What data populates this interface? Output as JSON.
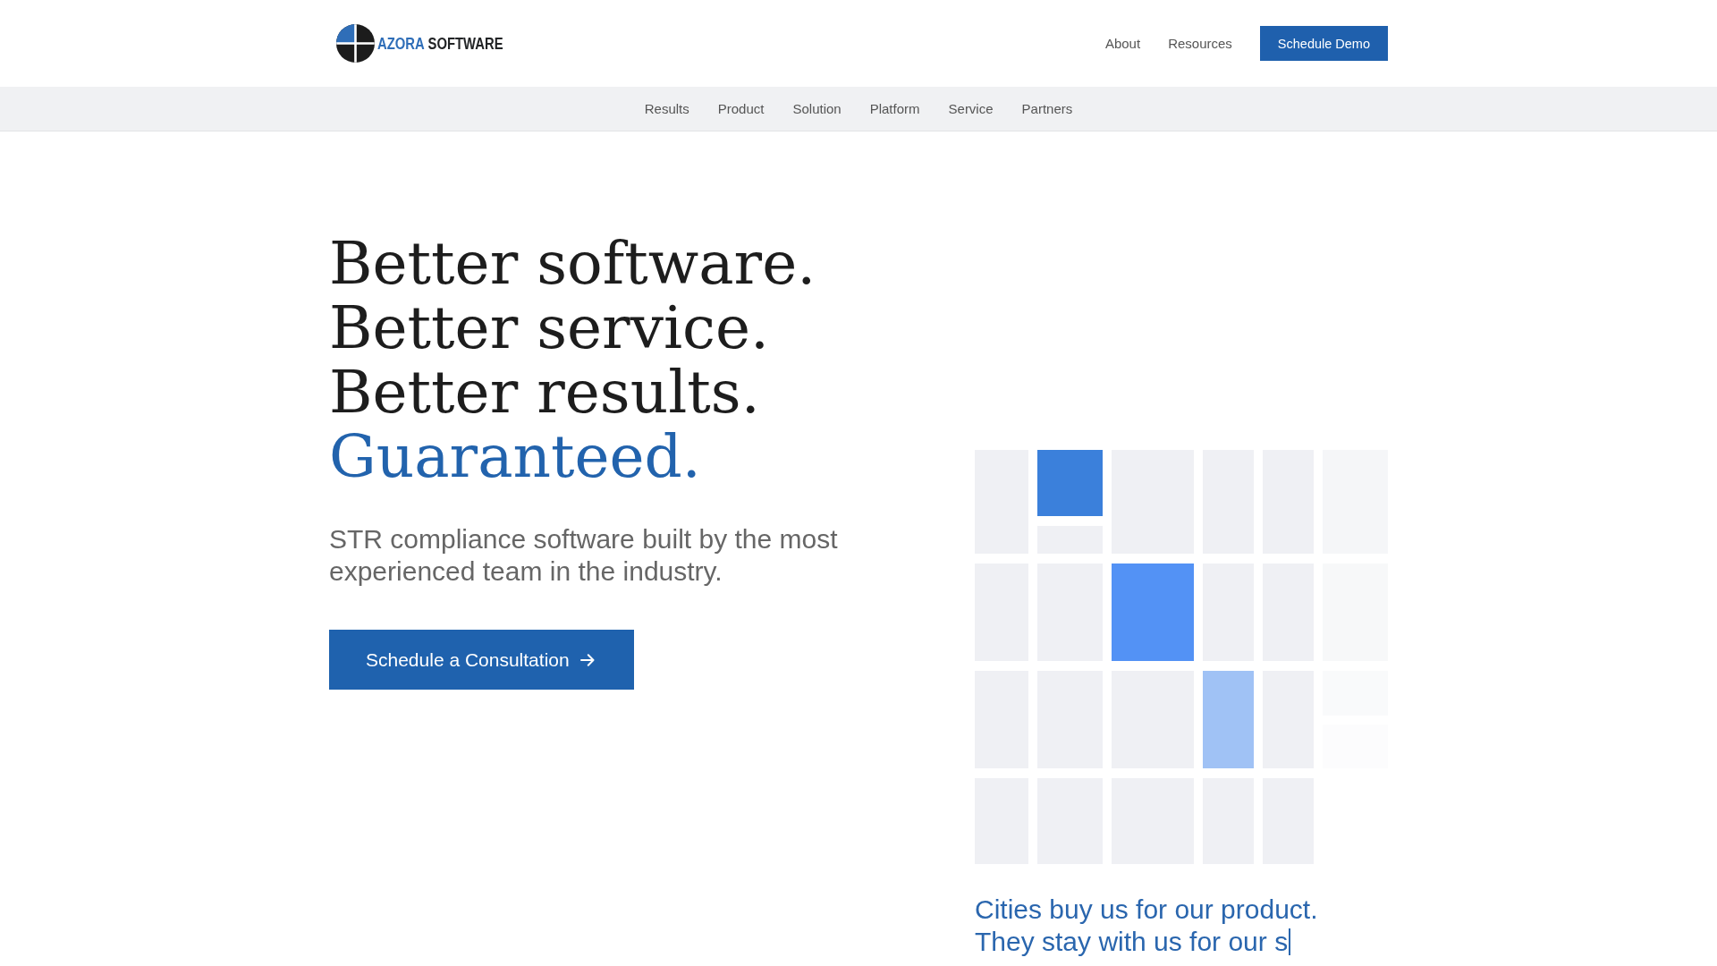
{
  "header": {
    "logo": {
      "brand": "AZORA",
      "product": "SOFTWARE"
    },
    "nav": [
      "About",
      "Resources"
    ],
    "cta": "Schedule Demo"
  },
  "subnav": {
    "items": [
      "Results",
      "Product",
      "Solution",
      "Platform",
      "Service",
      "Partners"
    ]
  },
  "hero": {
    "heading": [
      {
        "text": "Better software.",
        "accent": false
      },
      {
        "text": "Better service.",
        "accent": false
      },
      {
        "text": "Better results.",
        "accent": false
      },
      {
        "text": "Guaranteed.",
        "accent": true
      }
    ],
    "subtitle": "STR compliance software built by the most experienced team in the industry.",
    "button": "Schedule a Consultation"
  },
  "tagline": {
    "lines": [
      "Cities buy us for our product.",
      "They stay with us for our s"
    ],
    "cursor": true
  }
}
